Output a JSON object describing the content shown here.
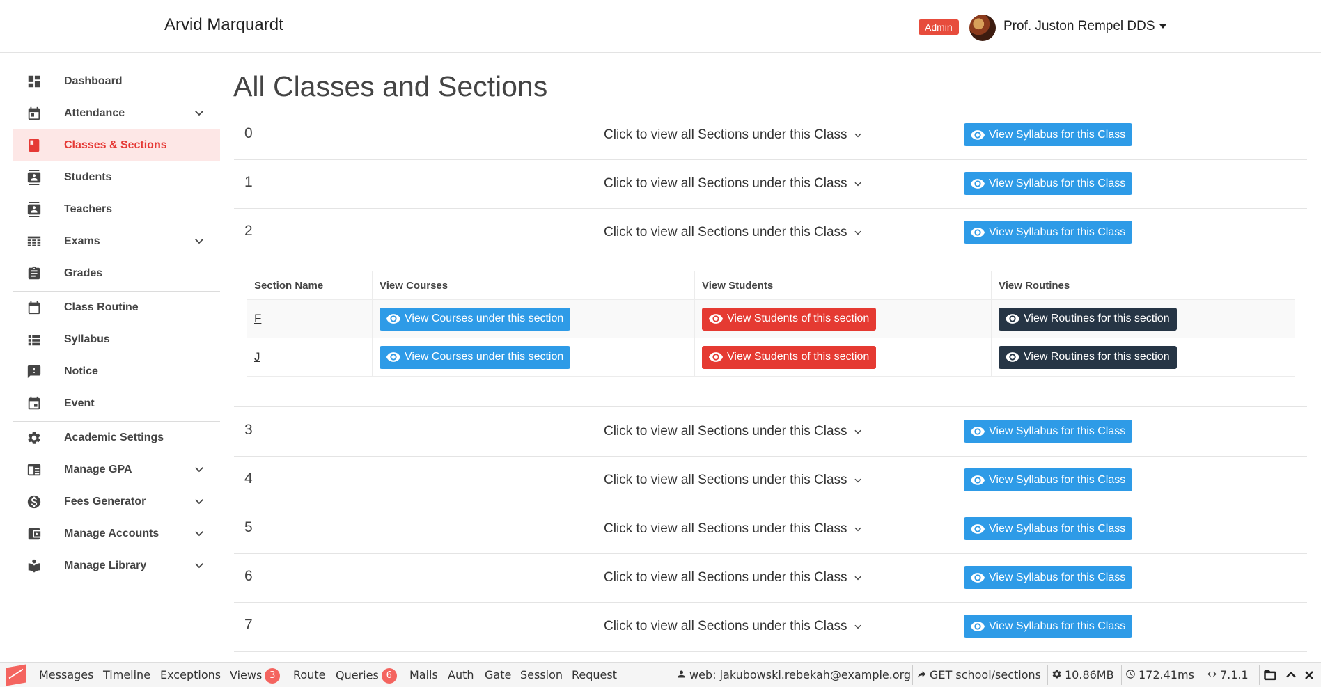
{
  "header": {
    "brand": "Arvid Marquardt",
    "role_badge": "Admin",
    "user_name": "Prof. Juston Rempel DDS"
  },
  "sidebar": {
    "items": [
      {
        "label": "Dashboard",
        "icon": "dashboard-icon",
        "has_submenu": false
      },
      {
        "label": "Attendance",
        "icon": "calendar-icon",
        "has_submenu": true
      },
      {
        "label": "Classes & Sections",
        "icon": "book-icon",
        "has_submenu": false,
        "active": true
      },
      {
        "label": "Students",
        "icon": "contact-card-icon",
        "has_submenu": false
      },
      {
        "label": "Teachers",
        "icon": "contact-card-icon",
        "has_submenu": false
      },
      {
        "label": "Exams",
        "icon": "table-icon",
        "has_submenu": true
      },
      {
        "label": "Grades",
        "icon": "clipboard-icon",
        "has_submenu": false
      },
      {
        "label": "Class Routine",
        "icon": "calendar-icon",
        "has_submenu": false
      },
      {
        "label": "Syllabus",
        "icon": "list-icon",
        "has_submenu": false
      },
      {
        "label": "Notice",
        "icon": "alert-message-icon",
        "has_submenu": false
      },
      {
        "label": "Event",
        "icon": "event-icon",
        "has_submenu": false
      },
      {
        "label": "Academic Settings",
        "icon": "gear-icon",
        "has_submenu": false
      },
      {
        "label": "Manage GPA",
        "icon": "card-icon",
        "has_submenu": true
      },
      {
        "label": "Fees Generator",
        "icon": "dollar-icon",
        "has_submenu": true
      },
      {
        "label": "Manage Accounts",
        "icon": "wallet-icon",
        "has_submenu": true
      },
      {
        "label": "Manage Library",
        "icon": "reader-icon",
        "has_submenu": true
      }
    ]
  },
  "main": {
    "title": "All Classes and Sections",
    "toggle_label": "Click to view all Sections under this Class",
    "syllabus_button": "View Syllabus for this Class",
    "classes": [
      "0",
      "1",
      "2",
      "3",
      "4",
      "5",
      "6",
      "7"
    ],
    "sections_table": {
      "headers": [
        "Section Name",
        "View Courses",
        "View Students",
        "View Routines"
      ],
      "rows": [
        {
          "name": "F",
          "courses": "View Courses under this section",
          "students": "View Students of this section",
          "routines": "View Routines for this section"
        },
        {
          "name": "J",
          "courses": "View Courses under this section",
          "students": "View Students of this section",
          "routines": "View Routines for this section"
        }
      ]
    }
  },
  "debugbar": {
    "tabs": [
      {
        "label": "Messages"
      },
      {
        "label": "Timeline"
      },
      {
        "label": "Exceptions"
      },
      {
        "label": "Views",
        "count": "3"
      },
      {
        "label": "Route"
      },
      {
        "label": "Queries",
        "count": "6"
      },
      {
        "label": "Mails"
      },
      {
        "label": "Auth"
      },
      {
        "label": "Gate"
      },
      {
        "label": "Session"
      },
      {
        "label": "Request"
      }
    ],
    "user": "web: jakubowski.rebekah@example.org",
    "route": "GET school/sections",
    "memory": "10.86MB",
    "time": "172.41ms",
    "php_version": "7.1.1"
  },
  "colors": {
    "primary": "#2e9be7",
    "danger": "#e53a32",
    "dark": "#263545",
    "active_bg": "#fde7e6"
  }
}
